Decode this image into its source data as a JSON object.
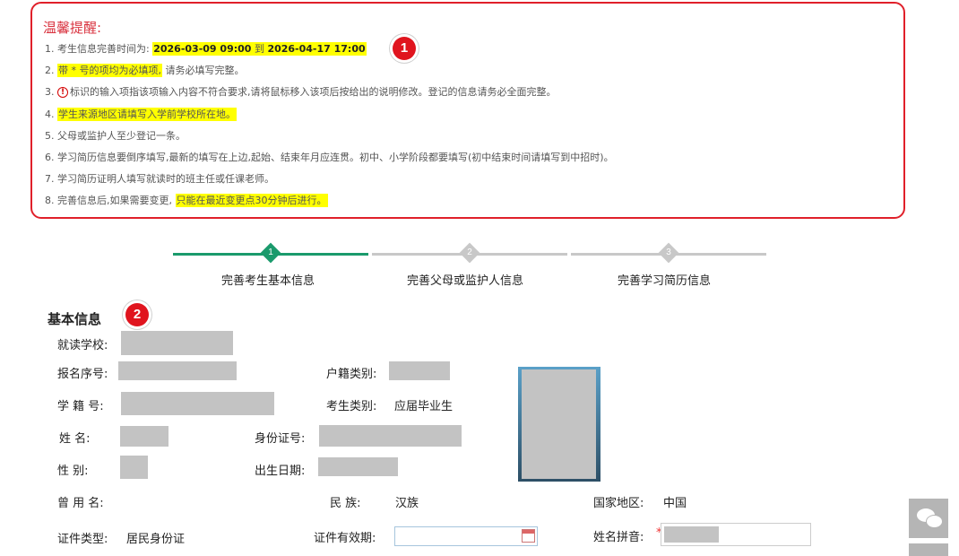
{
  "notice": {
    "title": "温馨提醒:",
    "items": {
      "i1": {
        "num": "1.",
        "pre": "考生信息完善时间为:",
        "start": "2026-03-09 09:00",
        "to": "到",
        "end": "2026-04-17 17:00"
      },
      "i2": {
        "num": "2.",
        "hl": "带 * 号的项均为必填项,",
        "rest": "请务必填写完整。"
      },
      "i3": {
        "num": "3.",
        "icon": "!",
        "rest": "标识的输入项指该项输入内容不符合要求,请将鼠标移入该项后按给出的说明修改。登记的信息请务必全面完整。"
      },
      "i4": {
        "num": "4.",
        "hl": "学生来源地区请填写入学前学校所在地。"
      },
      "i5": {
        "num": "5.",
        "rest": "父母或监护人至少登记一条。"
      },
      "i6": {
        "num": "6.",
        "rest": "学习简历信息要倒序填写,最新的填写在上边,起始、结束年月应连贯。初中、小学阶段都要填写(初中结束时间请填写到中招时)。"
      },
      "i7": {
        "num": "7.",
        "rest": "学习简历证明人填写就读时的班主任或任课老师。"
      },
      "i8": {
        "num": "8.",
        "pre": "完善信息后,如果需要变更,",
        "hl": "只能在最近变更点30分钟后进行。"
      }
    }
  },
  "annotations": {
    "badge1": "1",
    "badge2": "2"
  },
  "steps": [
    {
      "num": "1",
      "label": "完善考生基本信息",
      "status": "active"
    },
    {
      "num": "2",
      "label": "完善父母或监护人信息",
      "status": "pending"
    },
    {
      "num": "3",
      "label": "完善学习简历信息",
      "status": "pending"
    }
  ],
  "form": {
    "section_title": "基本信息",
    "school_label": "就读学校:",
    "reg_no_label": "报名序号:",
    "household_label": "户籍类别:",
    "student_no_label": "学 籍 号:",
    "candidate_type_label": "考生类别:",
    "candidate_type_value": "应届毕业生",
    "name_label": "姓    名:",
    "id_no_label": "身份证号:",
    "gender_label": "性    别:",
    "birth_label": "出生日期:",
    "former_name_label": "曾 用 名:",
    "ethnicity_label": "民    族:",
    "ethnicity_value": "汉族",
    "country_label": "国家地区:",
    "country_value": "中国",
    "cert_type_label": "证件类型:",
    "cert_type_value": "居民身份证",
    "cert_valid_label": "证件有效期:",
    "pinyin_label": "姓名拼音:",
    "required_mark": "*"
  },
  "colors": {
    "accent_green": "#1a9a6c",
    "pending_gray": "#c8c8c8",
    "alert_red": "#e0202a",
    "highlight": "#ffff00"
  }
}
